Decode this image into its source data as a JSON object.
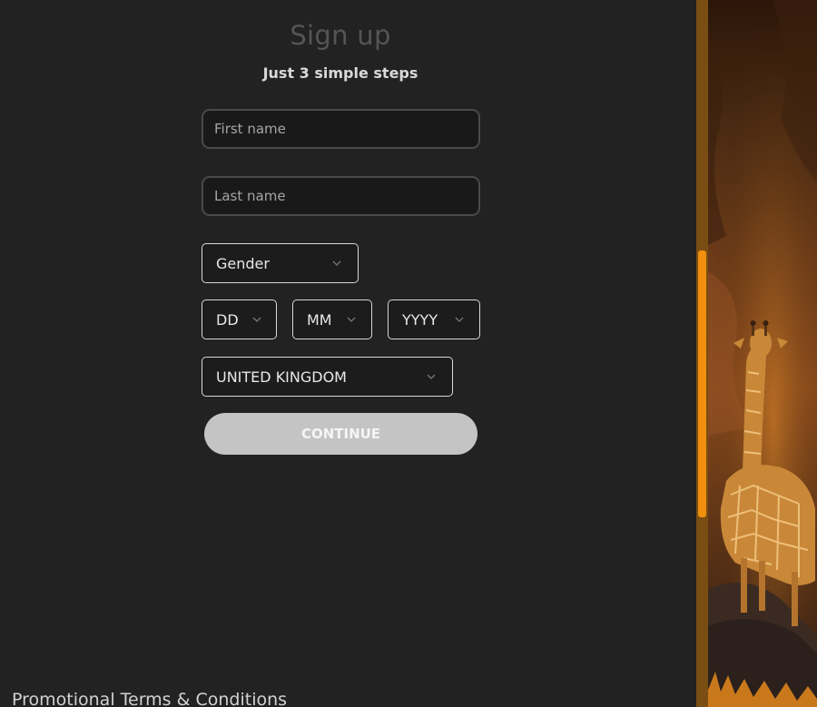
{
  "signup": {
    "title": "Sign up",
    "subtitle": "Just 3 simple steps",
    "first_name_placeholder": "First name",
    "last_name_placeholder": "Last name",
    "gender": "Gender",
    "dob_day": "DD",
    "dob_month": "MM",
    "dob_year": "YYYY",
    "country": "UNITED KINGDOM",
    "continue_label": "CONTINUE"
  },
  "footer": {
    "terms": "Promotional Terms & Conditions"
  },
  "colors": {
    "accent": "#f0900e",
    "background": "#222222",
    "button_disabled": "#c4c4c4"
  },
  "icons": {
    "select_arrow": "chevron-down-icon"
  },
  "side_image": {
    "subject": "giraffe-in-canyon-image"
  }
}
